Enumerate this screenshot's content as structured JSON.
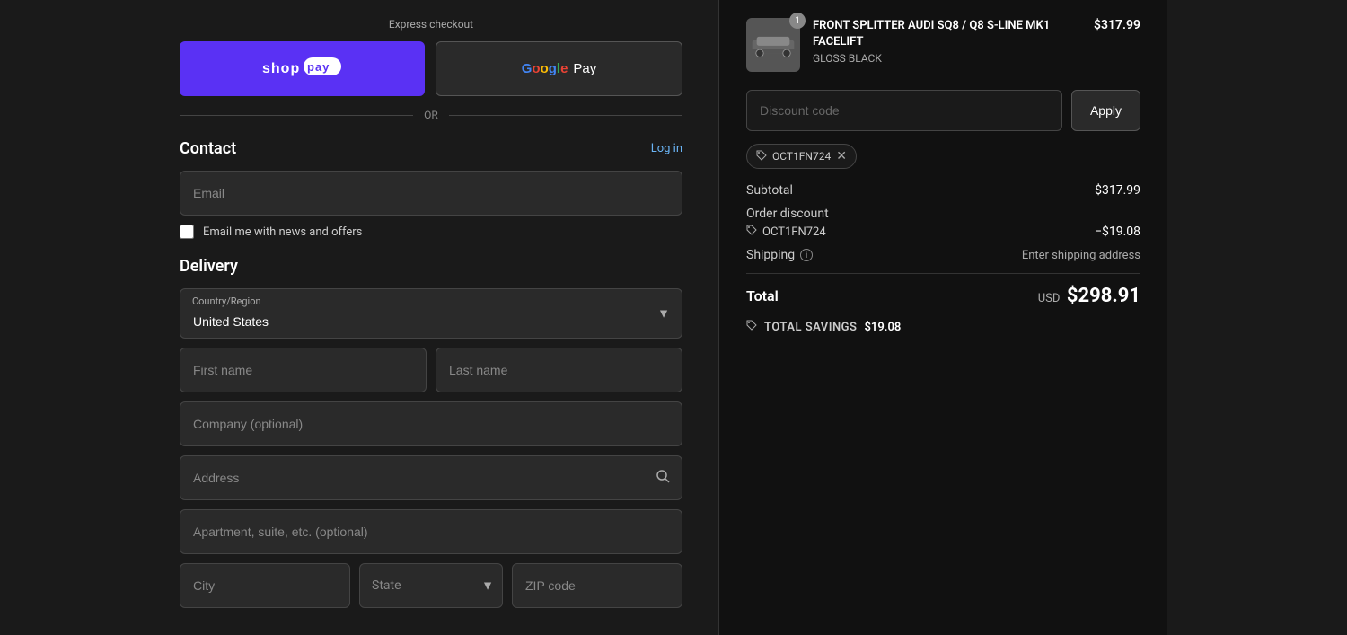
{
  "express": {
    "label": "Express checkout"
  },
  "shoppay": {
    "label": "shop pay"
  },
  "googlepay": {
    "label": "Pay"
  },
  "or_divider": "OR",
  "contact": {
    "title": "Contact",
    "login_link": "Log in",
    "email_placeholder": "Email",
    "newsletter_label": "Email me with news and offers"
  },
  "delivery": {
    "title": "Delivery",
    "country_label": "Country/Region",
    "country_value": "United States",
    "first_name_placeholder": "First name",
    "last_name_placeholder": "Last name",
    "company_placeholder": "Company (optional)",
    "address_placeholder": "Address",
    "apt_placeholder": "Apartment, suite, etc. (optional)",
    "city_placeholder": "City",
    "state_placeholder": "State",
    "zip_placeholder": "ZIP code"
  },
  "product": {
    "badge": "1",
    "name": "FRONT SPLITTER AUDI SQ8 / Q8 S-LINE MK1 FACELIFT",
    "variant": "GLOSS BLACK",
    "price": "$317.99"
  },
  "discount": {
    "input_placeholder": "Discount code",
    "apply_label": "Apply",
    "applied_code": "OCT1FN724"
  },
  "summary": {
    "subtotal_label": "Subtotal",
    "subtotal_value": "$317.99",
    "order_discount_label": "Order discount",
    "discount_code": "OCT1FN724",
    "discount_amount": "−$19.08",
    "shipping_label": "Shipping",
    "shipping_value": "Enter shipping address",
    "total_label": "Total",
    "total_currency": "USD",
    "total_value": "$298.91",
    "savings_label": "TOTAL SAVINGS",
    "savings_amount": "$19.08"
  }
}
